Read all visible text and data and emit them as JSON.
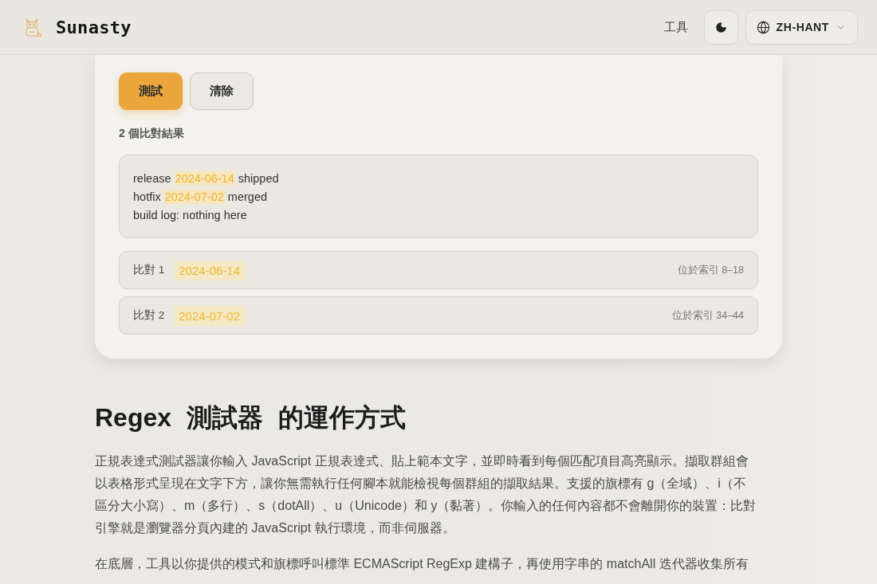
{
  "header": {
    "brand": "Sunasty",
    "nav_link": "工具",
    "language": "ZH-HANT"
  },
  "actions": [
    {
      "label": "測試",
      "kind": "primary"
    },
    {
      "label": "清除",
      "kind": "secondary"
    }
  ],
  "result_count": "2 個比對結果",
  "preview": {
    "lines": [
      {
        "segments": [
          {
            "text": "release",
            "match": false
          },
          {
            "text": "2024-06-14",
            "match": true
          },
          {
            "text": "shipped",
            "match": false
          }
        ]
      },
      {
        "segments": [
          {
            "text": "hotfix",
            "match": false
          },
          {
            "text": "2024-07-02",
            "match": true
          },
          {
            "text": "merged",
            "match": false
          }
        ]
      },
      {
        "segments": [
          {
            "text": "build log: nothing here",
            "match": false
          }
        ]
      }
    ]
  },
  "matches": [
    {
      "label": "比對 1",
      "value": "2024-06-14",
      "position": "位於索引 8–18"
    },
    {
      "label": "比對 2",
      "value": "2024-07-02",
      "position": "位於索引 34–44"
    }
  ],
  "article": {
    "heading": "Regex 測試器 的運作方式",
    "paragraphs": [
      "正規表達式測試器讓你輸入 JavaScript 正規表達式、貼上範本文字，並即時看到每個匹配項目高亮顯示。擷取群組會以表格形式呈現在文字下方，讓你無需執行任何腳本就能檢視每個群組的擷取結果。支援的旗標有 g（全域）、i（不區分大小寫）、m（多行）、s（dotAll）、u（Unicode）和 y（黏著）。你輸入的任何內容都不會離開你的裝置：比對引擎就是瀏覽器分頁內建的 JavaScript 執行環境，而非伺服器。",
      "在底層，工具以你提供的模式和旗標呼叫標準 ECMAScript RegExp 建構子，再使用字串的 matchAll 迭代器收集所有"
    ]
  }
}
